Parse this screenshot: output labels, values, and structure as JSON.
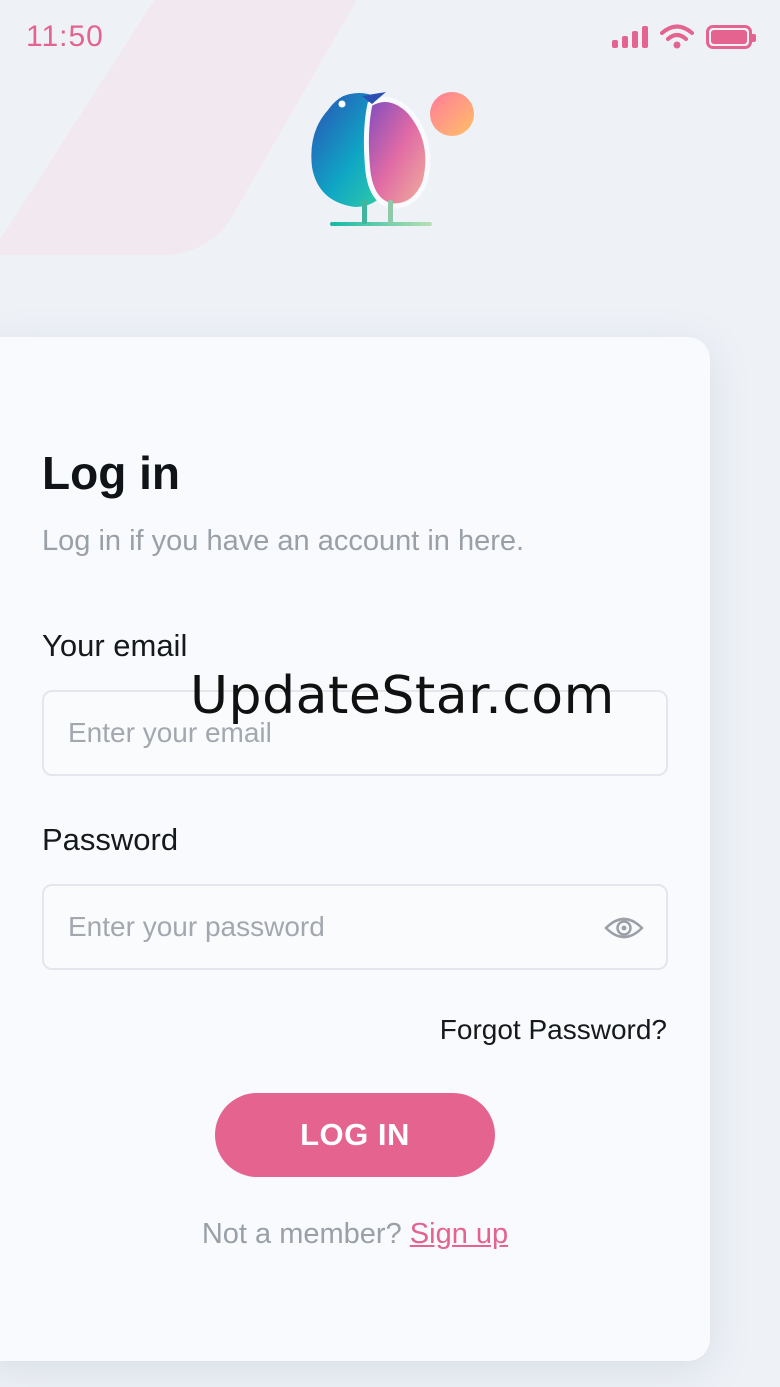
{
  "status_bar": {
    "time": "11:50",
    "icons": [
      "signal-icon",
      "wifi-icon",
      "battery-icon"
    ]
  },
  "logo": {
    "icon": "bird-logo"
  },
  "login": {
    "title": "Log in",
    "subtitle": "Log in if you have an account in here.",
    "email_label": "Your email",
    "email_placeholder": "Enter your email",
    "email_value": "",
    "password_label": "Password",
    "password_placeholder": "Enter your password",
    "password_value": "",
    "password_toggle_icon": "eye-icon",
    "forgot_label": "Forgot Password?",
    "submit_label": "LOG IN",
    "signup_prompt": "Not a member?",
    "signup_link": "Sign up"
  },
  "watermark": "UpdateStar.com",
  "colors": {
    "accent": "#e4638f",
    "background": "#eef2f7",
    "card": "#f8fafd"
  }
}
